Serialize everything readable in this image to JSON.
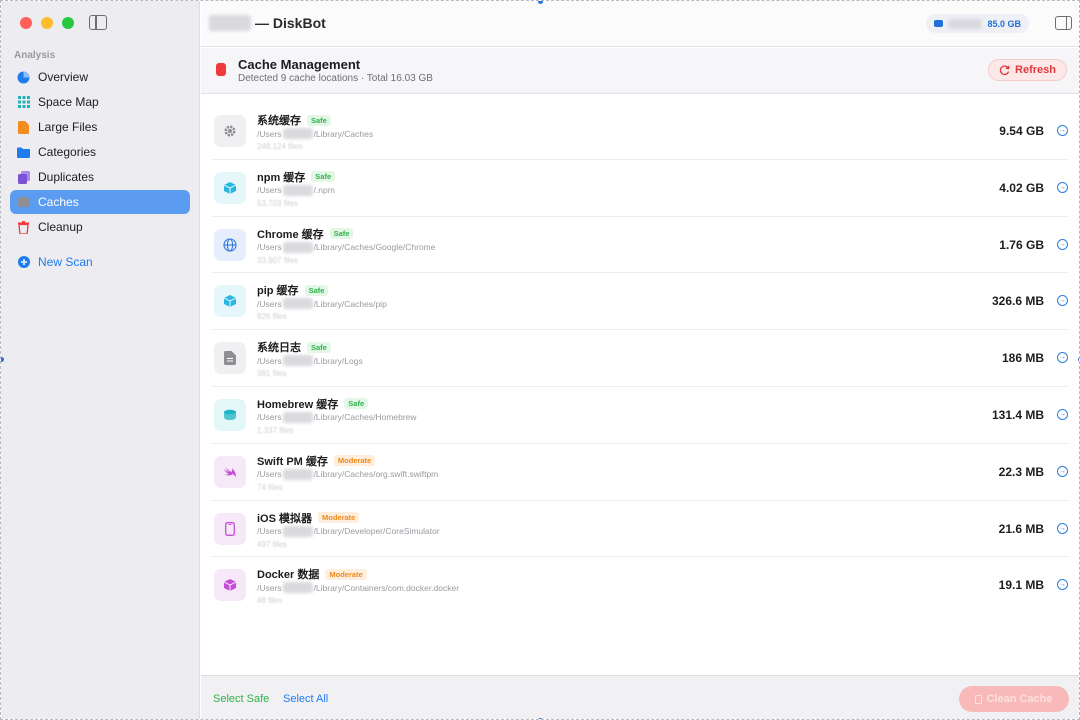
{
  "window": {
    "title": "— DiskBot"
  },
  "disk": {
    "free_label": "85.0 GB"
  },
  "sidebar": {
    "section": "Analysis",
    "items": [
      {
        "label": "Overview",
        "icon": "pie-chart-icon",
        "color": "#1e7cf1"
      },
      {
        "label": "Space Map",
        "icon": "grid-icon",
        "color": "#1fb2b8"
      },
      {
        "label": "Large Files",
        "icon": "document-icon",
        "color": "#f28c1d"
      },
      {
        "label": "Categories",
        "icon": "folder-icon",
        "color": "#1e7cf1"
      },
      {
        "label": "Duplicates",
        "icon": "duplicate-icon",
        "color": "#7b54d6"
      },
      {
        "label": "Caches",
        "icon": "cache-icon",
        "color": "#8e8e93"
      },
      {
        "label": "Cleanup",
        "icon": "trash-icon",
        "color": "#ef3b3b"
      }
    ],
    "new_scan": "New Scan"
  },
  "header": {
    "title": "Cache Management",
    "subtitle": "Detected 9 cache locations · Total 16.03 GB",
    "refresh": "Refresh"
  },
  "caches": [
    {
      "name": "系统缓存",
      "badge": "Safe",
      "path_pre": "/Users",
      "path_post": "/Library/Caches",
      "files": "248,124 files",
      "size": "9.54 GB",
      "icon": "gear-icon",
      "bg": "#f0f0f2",
      "fg": "#8e8e93"
    },
    {
      "name": "npm 缓存",
      "badge": "Safe",
      "path_pre": "/Users",
      "path_post": "/.npm",
      "files": "53,703 files",
      "size": "4.02 GB",
      "icon": "package-icon",
      "bg": "#e5f7fb",
      "fg": "#2bb6e0"
    },
    {
      "name": "Chrome 缓存",
      "badge": "Safe",
      "path_pre": "/Users",
      "path_post": "/Library/Caches/Google/Chrome",
      "files": "33,907 files",
      "size": "1.76 GB",
      "icon": "globe-icon",
      "bg": "#e6eefb",
      "fg": "#3178e0"
    },
    {
      "name": "pip 缓存",
      "badge": "Safe",
      "path_pre": "/Users",
      "path_post": "/Library/Caches/pip",
      "files": "826 files",
      "size": "326.6 MB",
      "icon": "package-icon",
      "bg": "#e5f7fb",
      "fg": "#2bb6e0"
    },
    {
      "name": "系统日志",
      "badge": "Safe",
      "path_pre": "/Users",
      "path_post": "/Library/Logs",
      "files": "381 files",
      "size": "186 MB",
      "icon": "log-document-icon",
      "bg": "#f0f0f2",
      "fg": "#8e8e93"
    },
    {
      "name": "Homebrew 缓存",
      "badge": "Safe",
      "path_pre": "/Users",
      "path_post": "/Library/Caches/Homebrew",
      "files": "1,337 files",
      "size": "131.4 MB",
      "icon": "mug-icon",
      "bg": "#e3f6f8",
      "fg": "#1fb2c4"
    },
    {
      "name": "Swift PM 缓存",
      "badge": "Moderate",
      "path_pre": "/Users",
      "path_post": "/Library/Caches/org.swift.swiftpm",
      "files": "74 files",
      "size": "22.3 MB",
      "icon": "swift-icon",
      "bg": "#f6e8f8",
      "fg": "#c44fd6"
    },
    {
      "name": "iOS 模拟器",
      "badge": "Moderate",
      "path_pre": "/Users",
      "path_post": "/Library/Developer/CoreSimulator",
      "files": "497 files",
      "size": "21.6 MB",
      "icon": "iphone-icon",
      "bg": "#f6e8f8",
      "fg": "#c44fd6"
    },
    {
      "name": "Docker 数据",
      "badge": "Moderate",
      "path_pre": "/Users",
      "path_post": "/Library/Containers/com.docker.docker",
      "files": "48 files",
      "size": "19.1 MB",
      "icon": "cube-icon",
      "bg": "#f6e8f8",
      "fg": "#c44fd6"
    }
  ],
  "footer": {
    "select_safe": "Select Safe",
    "select_all": "Select All",
    "clean": "Clean Cache"
  }
}
